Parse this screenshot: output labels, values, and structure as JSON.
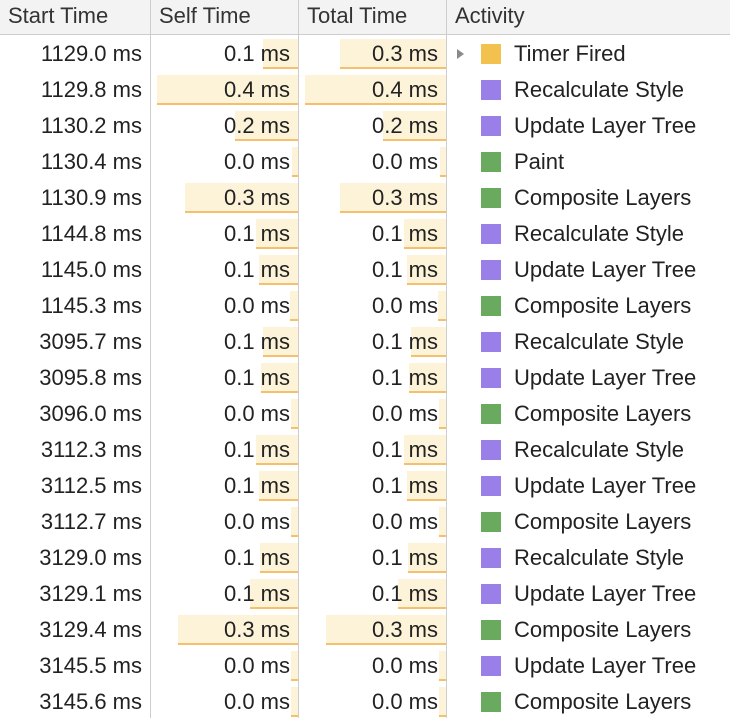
{
  "columns": {
    "start": "Start Time",
    "self": "Self Time",
    "total": "Total Time",
    "activity": "Activity"
  },
  "colors": {
    "scripting": "#f2c14e",
    "rendering": "#9b7fe8",
    "painting": "#6aaa5e",
    "bar_fill": "#fdf3d8",
    "bar_edge": "#f5c06b"
  },
  "rows": [
    {
      "start": "1129.0 ms",
      "self": "0.1 ms",
      "total": "0.3 ms",
      "activity": "Timer Fired",
      "category": "scripting",
      "expandable": true,
      "self_frac": 0.25,
      "total_frac": 0.75
    },
    {
      "start": "1129.8 ms",
      "self": "0.4 ms",
      "total": "0.4 ms",
      "activity": "Recalculate Style",
      "category": "rendering",
      "expandable": false,
      "self_frac": 1.0,
      "total_frac": 1.0
    },
    {
      "start": "1130.2 ms",
      "self": "0.2 ms",
      "total": "0.2 ms",
      "activity": "Update Layer Tree",
      "category": "rendering",
      "expandable": false,
      "self_frac": 0.45,
      "total_frac": 0.45
    },
    {
      "start": "1130.4 ms",
      "self": "0.0 ms",
      "total": "0.0 ms",
      "activity": "Paint",
      "category": "painting",
      "expandable": false,
      "self_frac": 0.04,
      "total_frac": 0.04
    },
    {
      "start": "1130.9 ms",
      "self": "0.3 ms",
      "total": "0.3 ms",
      "activity": "Composite Layers",
      "category": "painting",
      "expandable": false,
      "self_frac": 0.8,
      "total_frac": 0.75
    },
    {
      "start": "1144.8 ms",
      "self": "0.1 ms",
      "total": "0.1 ms",
      "activity": "Recalculate Style",
      "category": "rendering",
      "expandable": false,
      "self_frac": 0.3,
      "total_frac": 0.3
    },
    {
      "start": "1145.0 ms",
      "self": "0.1 ms",
      "total": "0.1 ms",
      "activity": "Update Layer Tree",
      "category": "rendering",
      "expandable": false,
      "self_frac": 0.28,
      "total_frac": 0.28
    },
    {
      "start": "1145.3 ms",
      "self": "0.0 ms",
      "total": "0.0 ms",
      "activity": "Composite Layers",
      "category": "painting",
      "expandable": false,
      "self_frac": 0.06,
      "total_frac": 0.06
    },
    {
      "start": "3095.7 ms",
      "self": "0.1 ms",
      "total": "0.1 ms",
      "activity": "Recalculate Style",
      "category": "rendering",
      "expandable": false,
      "self_frac": 0.25,
      "total_frac": 0.25
    },
    {
      "start": "3095.8 ms",
      "self": "0.1 ms",
      "total": "0.1 ms",
      "activity": "Update Layer Tree",
      "category": "rendering",
      "expandable": false,
      "self_frac": 0.26,
      "total_frac": 0.26
    },
    {
      "start": "3096.0 ms",
      "self": "0.0 ms",
      "total": "0.0 ms",
      "activity": "Composite Layers",
      "category": "painting",
      "expandable": false,
      "self_frac": 0.05,
      "total_frac": 0.05
    },
    {
      "start": "3112.3 ms",
      "self": "0.1 ms",
      "total": "0.1 ms",
      "activity": "Recalculate Style",
      "category": "rendering",
      "expandable": false,
      "self_frac": 0.3,
      "total_frac": 0.3
    },
    {
      "start": "3112.5 ms",
      "self": "0.1 ms",
      "total": "0.1 ms",
      "activity": "Update Layer Tree",
      "category": "rendering",
      "expandable": false,
      "self_frac": 0.28,
      "total_frac": 0.28
    },
    {
      "start": "3112.7 ms",
      "self": "0.0 ms",
      "total": "0.0 ms",
      "activity": "Composite Layers",
      "category": "painting",
      "expandable": false,
      "self_frac": 0.05,
      "total_frac": 0.05
    },
    {
      "start": "3129.0 ms",
      "self": "0.1 ms",
      "total": "0.1 ms",
      "activity": "Recalculate Style",
      "category": "rendering",
      "expandable": false,
      "self_frac": 0.27,
      "total_frac": 0.27
    },
    {
      "start": "3129.1 ms",
      "self": "0.1 ms",
      "total": "0.1 ms",
      "activity": "Update Layer Tree",
      "category": "rendering",
      "expandable": false,
      "self_frac": 0.34,
      "total_frac": 0.34
    },
    {
      "start": "3129.4 ms",
      "self": "0.3 ms",
      "total": "0.3 ms",
      "activity": "Composite Layers",
      "category": "painting",
      "expandable": false,
      "self_frac": 0.85,
      "total_frac": 0.85
    },
    {
      "start": "3145.5 ms",
      "self": "0.0 ms",
      "total": "0.0 ms",
      "activity": "Update Layer Tree",
      "category": "rendering",
      "expandable": false,
      "self_frac": 0.05,
      "total_frac": 0.05
    },
    {
      "start": "3145.6 ms",
      "self": "0.0 ms",
      "total": "0.0 ms",
      "activity": "Composite Layers",
      "category": "painting",
      "expandable": false,
      "self_frac": 0.05,
      "total_frac": 0.05
    }
  ]
}
